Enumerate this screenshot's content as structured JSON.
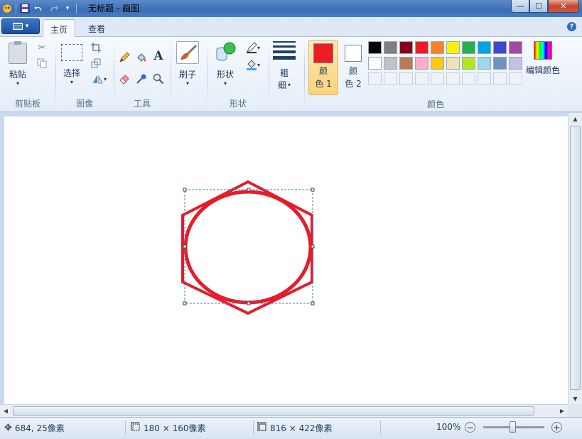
{
  "window": {
    "title": "无标题 - 画图",
    "controls": {
      "minimize": "—",
      "maximize": "☐",
      "close": "✕"
    }
  },
  "quick_access": [
    "paint-app-icon",
    "save-icon",
    "undo-icon",
    "redo-icon",
    "customize-arrow-icon"
  ],
  "tabs": [
    {
      "label": "主页",
      "active": true
    },
    {
      "label": "查看",
      "active": false
    }
  ],
  "ribbon": {
    "clipboard": {
      "paste": "粘贴",
      "group": "剪贴板"
    },
    "image": {
      "select": "选择",
      "group": "图像"
    },
    "tools": {
      "group": "工具",
      "text_glyph": "A"
    },
    "brushes": {
      "label": "刷子"
    },
    "shapes": {
      "label": "形状",
      "group": "形状"
    },
    "size": {
      "line1": "粗",
      "line2": "细"
    },
    "colors": {
      "color1_line1": "颜",
      "color1_line2": "色 1",
      "color2_line1": "颜",
      "color2_line2": "色 2",
      "edit": "编辑颜色",
      "group": "颜色",
      "color1": "#ed1c24",
      "color2": "#ffffff",
      "palette_row1": [
        "#000000",
        "#7f7f7f",
        "#880015",
        "#ed1c24",
        "#ff7f27",
        "#fff200",
        "#22b14c",
        "#00a2e8",
        "#3f48cc",
        "#a349a4"
      ],
      "palette_row2": [
        "#ffffff",
        "#c3c3c3",
        "#b97a57",
        "#ffaec9",
        "#ffc90e",
        "#efe4b0",
        "#b5e61d",
        "#99d9ea",
        "#7092be",
        "#c8bfe7"
      ]
    }
  },
  "canvas": {
    "stroke_color": "#e31e2a",
    "selection_color": "#3a7fd0"
  },
  "status": {
    "cursor": "684, 25像素",
    "selection_size": "180 × 160像素",
    "image_size": "816 × 422像素",
    "zoom": "100%",
    "zoom_level": 1.0,
    "zoom_out": "−",
    "zoom_in": "+"
  }
}
